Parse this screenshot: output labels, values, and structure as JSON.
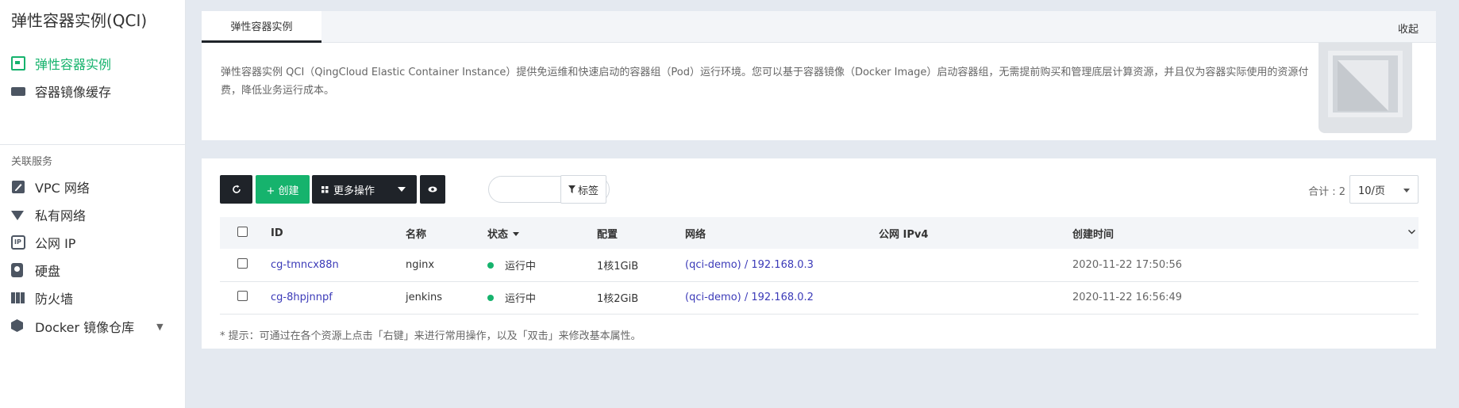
{
  "sidebar": {
    "title": "弹性容器实例(QCI)",
    "items": [
      {
        "label": "弹性容器实例",
        "icon": "image-icon",
        "active": true
      },
      {
        "label": "容器镜像缓存",
        "icon": "cache-icon"
      }
    ],
    "section_label": "关联服务",
    "related": [
      {
        "label": "VPC 网络",
        "icon": "pencil-icon"
      },
      {
        "label": "私有网络",
        "icon": "wifi-icon"
      },
      {
        "label": "公网 IP",
        "icon": "ip-icon",
        "icon_text": "IP"
      },
      {
        "label": "硬盘",
        "icon": "disk-icon"
      },
      {
        "label": "防火墙",
        "icon": "firewall-icon"
      },
      {
        "label": "Docker 镜像仓库",
        "icon": "cube-icon",
        "caret": "▼"
      }
    ]
  },
  "intro": {
    "tab": "弹性容器实例",
    "collapse": "收起",
    "description": "弹性容器实例 QCI（QingCloud Elastic Container Instance）提供免运维和快速启动的容器组（Pod）运行环境。您可以基于容器镜像（Docker Image）启动容器组，无需提前购买和管理底层计算资源，并且仅为容器实际使用的资源付费，降低业务运行成本。"
  },
  "toolbar": {
    "refresh_icon": "refresh-icon",
    "create_label": "+ 创建",
    "more_label": "更多操作",
    "tag_label": "标签",
    "total_label": "合计 : 2",
    "page_size": "10/页"
  },
  "table": {
    "columns": [
      "ID",
      "名称",
      "状态",
      "配置",
      "网络",
      "公网 IPv4",
      "创建时间"
    ],
    "rows": [
      {
        "id": "cg-tmncx88n",
        "name": "nginx",
        "status": "运行中",
        "status_color": "#16b36d",
        "config": "1核1GiB",
        "network": "(qci-demo) / 192.168.0.3",
        "eip": "",
        "created": "2020-11-22 17:50:56"
      },
      {
        "id": "cg-8hpjnnpf",
        "name": "jenkins",
        "status": "运行中",
        "status_color": "#16b36d",
        "config": "1核2GiB",
        "network": "(qci-demo) / 192.168.0.2",
        "eip": "",
        "created": "2020-11-22 16:56:49"
      }
    ]
  },
  "hint": "* 提示：可通过在各个资源上点击「右键」来进行常用操作，以及「双击」来修改基本属性。",
  "colors": {
    "accent": "#16b36d",
    "dark": "#1f2329",
    "link": "#3b3ab8",
    "background": "#e4e9f0"
  }
}
